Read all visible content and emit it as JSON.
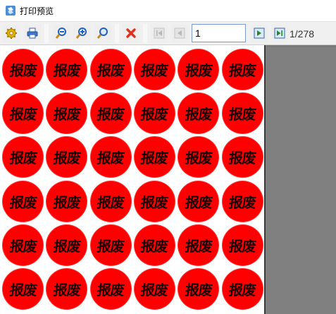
{
  "window": {
    "title": "打印预览"
  },
  "toolbar": {
    "buttons": [
      {
        "name": "page-setup",
        "icon": "gear-icon"
      },
      {
        "name": "print",
        "icon": "printer-icon"
      },
      {
        "name": "zoom-out",
        "icon": "zoom-out-icon"
      },
      {
        "name": "zoom-in",
        "icon": "zoom-in-icon"
      },
      {
        "name": "zoom-fit",
        "icon": "magnifier-icon"
      },
      {
        "name": "close",
        "icon": "close-icon"
      },
      {
        "name": "first-page",
        "icon": "first-page-icon"
      },
      {
        "name": "prev-page",
        "icon": "prev-page-icon"
      },
      {
        "name": "next-page",
        "icon": "next-page-icon"
      },
      {
        "name": "last-page",
        "icon": "last-page-icon"
      }
    ],
    "page_value": "1",
    "total_pages": "1/278"
  },
  "preview": {
    "stamp_text": "报废",
    "stamp_color": "#ff0000",
    "rows": 6,
    "cols": 6
  }
}
